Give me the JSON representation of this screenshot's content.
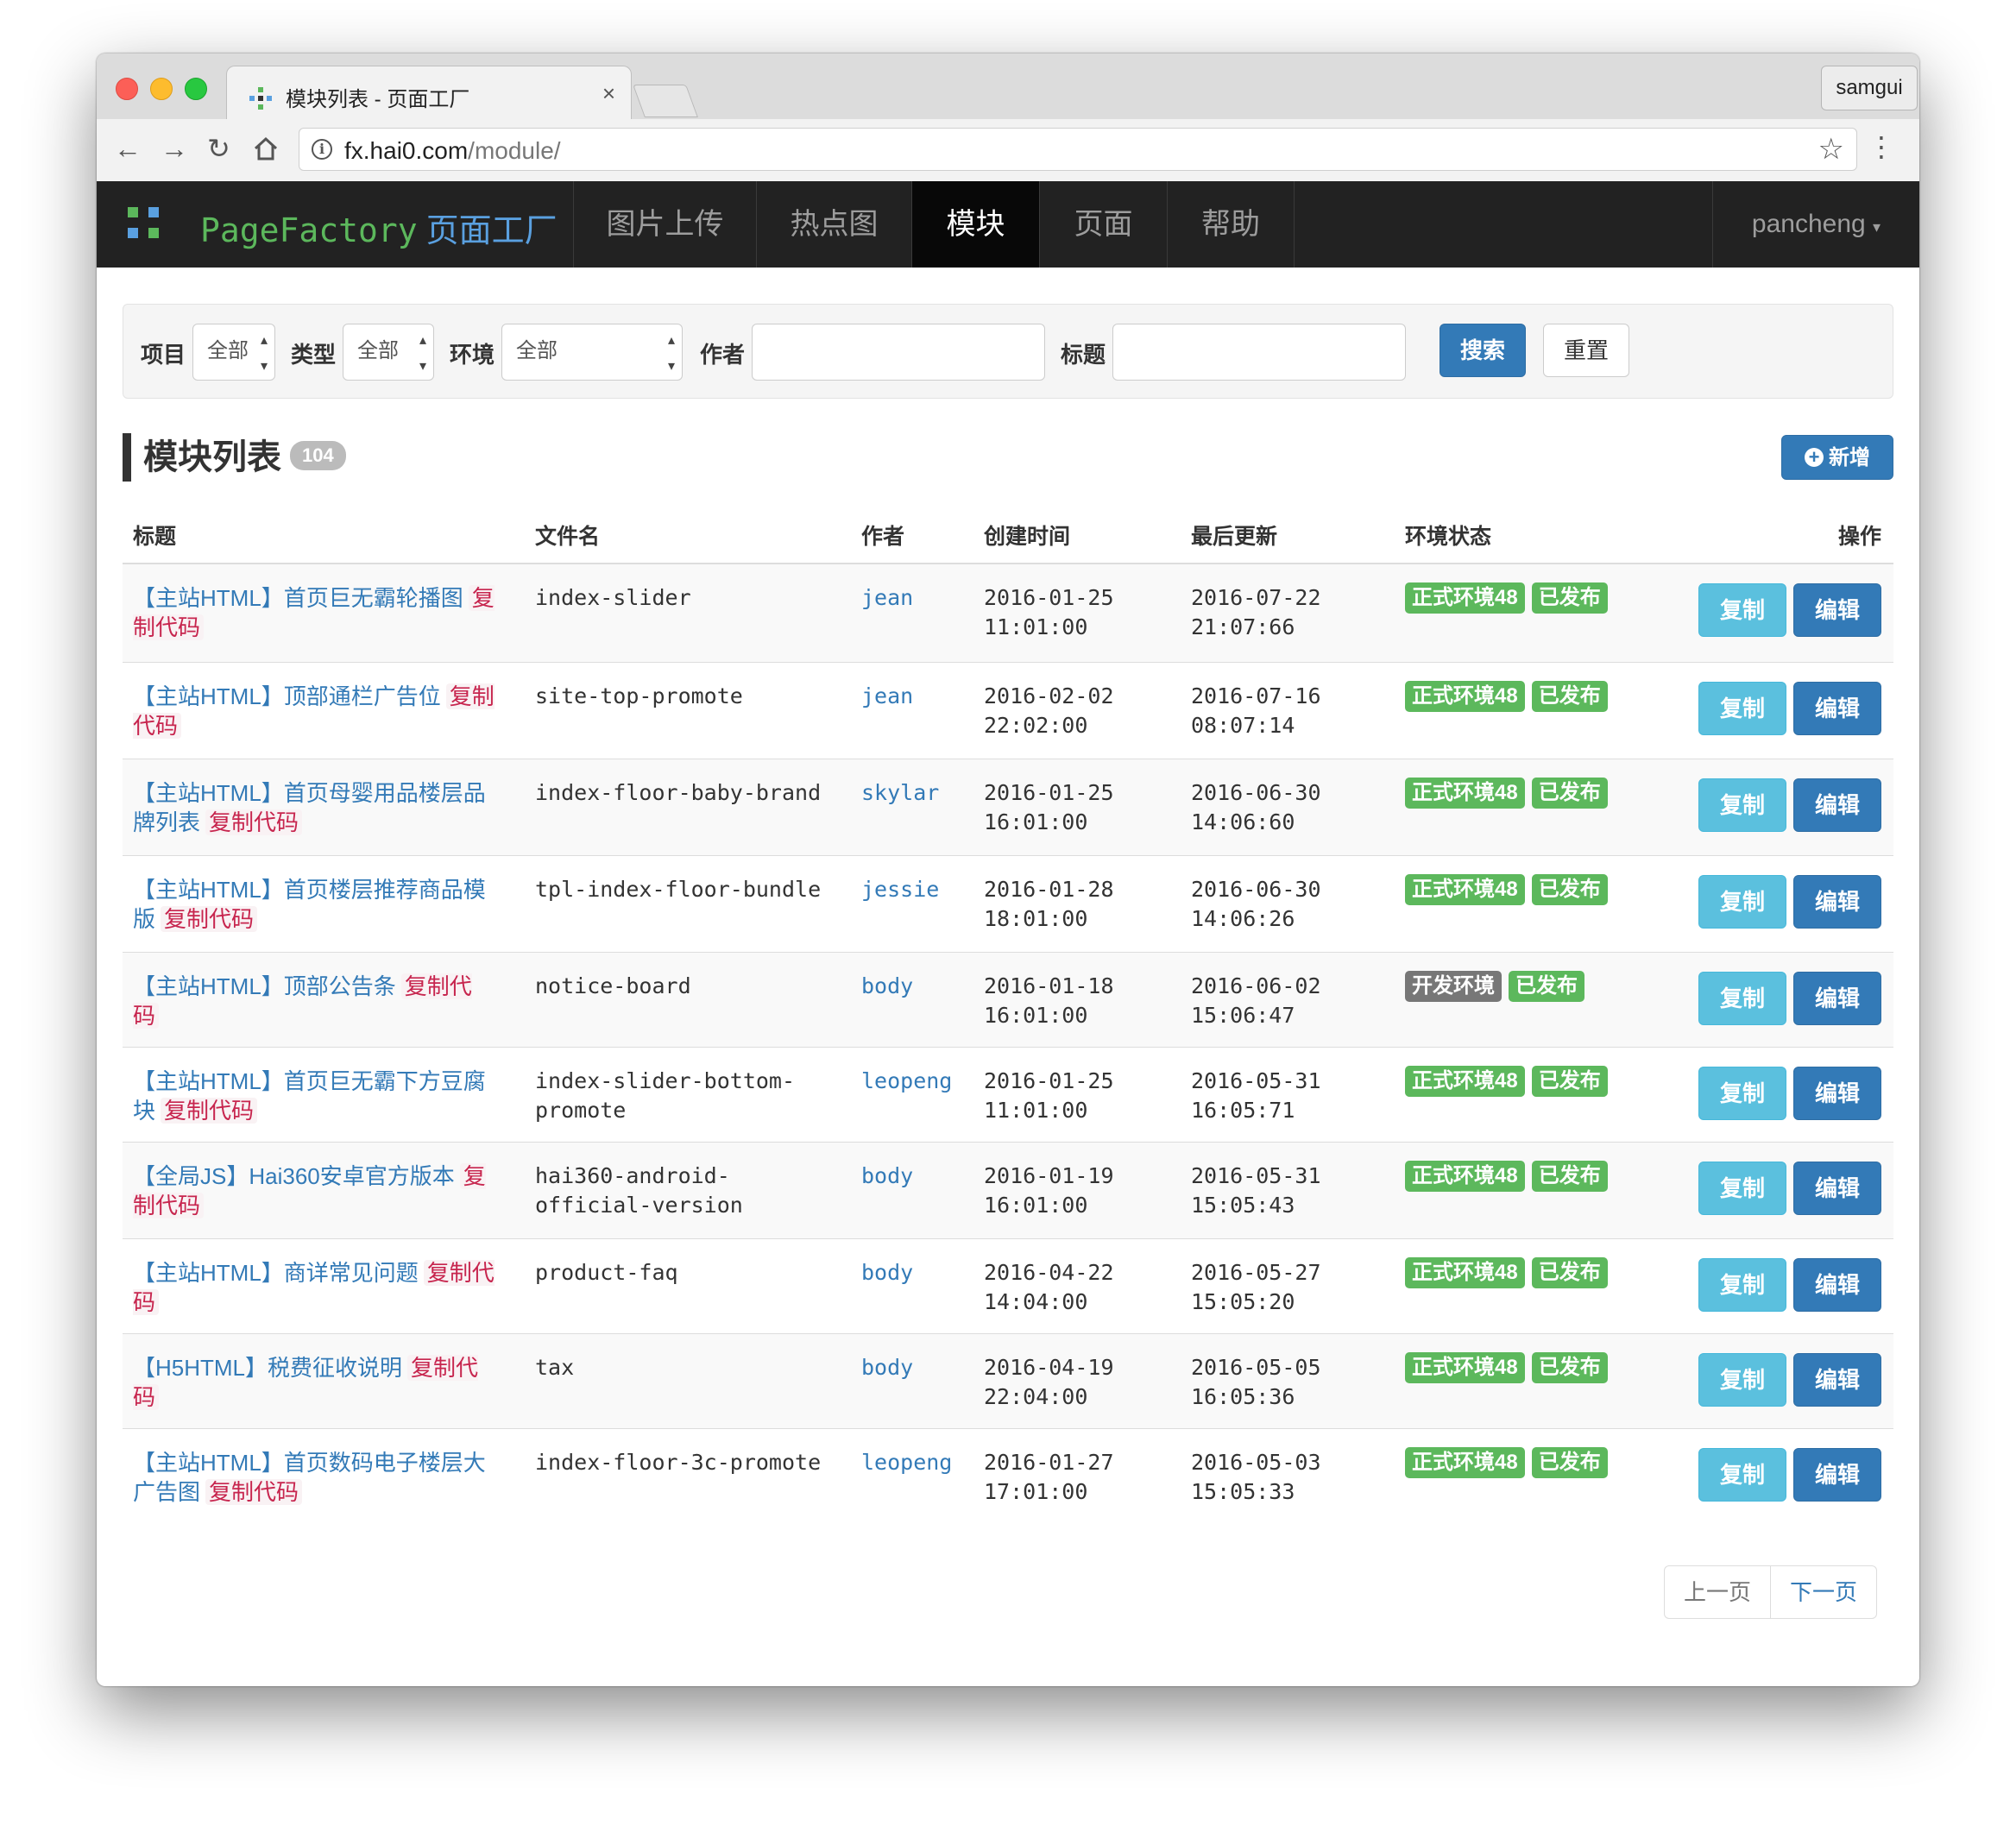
{
  "browser": {
    "tab_title": "模块列表 - 页面工厂",
    "tab_close": "×",
    "profile": "samgui",
    "url_host": "fx.hai0.com",
    "url_path": "/module/"
  },
  "navbar": {
    "brand": "PageFactory",
    "brand_cn": "页面工厂",
    "items": [
      {
        "label": "图片上传",
        "active": false
      },
      {
        "label": "热点图",
        "active": false
      },
      {
        "label": "模块",
        "active": true
      },
      {
        "label": "页面",
        "active": false
      },
      {
        "label": "帮助",
        "active": false
      }
    ],
    "user": "pancheng"
  },
  "filter": {
    "project_label": "项目",
    "project_value": "全部",
    "type_label": "类型",
    "type_value": "全部",
    "env_label": "环境",
    "env_value": "全部",
    "author_label": "作者",
    "author_value": "",
    "title_label": "标题",
    "title_value": "",
    "search_button": "搜索",
    "reset_button": "重置"
  },
  "heading": {
    "title": "模块列表",
    "count": "104",
    "add_button": "新增"
  },
  "table": {
    "columns": [
      "标题",
      "文件名",
      "作者",
      "创建时间",
      "最后更新",
      "环境状态",
      "操作"
    ],
    "copy_code_label": "复制代码",
    "copy_button": "复制",
    "edit_button": "编辑",
    "rows": [
      {
        "title_1": "【主站HTML】首页巨无霸轮播图",
        "title_2": "",
        "file_1": "index-slider",
        "file_2": "",
        "author": "jean",
        "created_date": "2016-01-25",
        "created_time": "11:01:00",
        "updated_date": "2016-07-22",
        "updated_time": "21:07:66",
        "env": "正式环境48",
        "env_color": "#5cb85c",
        "status": "已发布"
      },
      {
        "title_1": "【主站HTML】顶部通栏广告位",
        "title_2": "",
        "file_1": "site-top-promote",
        "file_2": "",
        "author": "jean",
        "created_date": "2016-02-02",
        "created_time": "22:02:00",
        "updated_date": "2016-07-16",
        "updated_time": "08:07:14",
        "env": "正式环境48",
        "env_color": "#5cb85c",
        "status": "已发布"
      },
      {
        "title_1": "【主站HTML】首页母婴用品楼层品牌列",
        "title_2": "表",
        "file_1": "index-floor-baby-brand",
        "file_2": "",
        "author": "skylar",
        "created_date": "2016-01-25",
        "created_time": "16:01:00",
        "updated_date": "2016-06-30",
        "updated_time": "14:06:60",
        "env": "正式环境48",
        "env_color": "#5cb85c",
        "status": "已发布"
      },
      {
        "title_1": "【主站HTML】首页楼层推荐商品模版",
        "title_2": "",
        "file_1": "tpl-index-floor-bundle",
        "file_2": "",
        "author": "jessie",
        "created_date": "2016-01-28",
        "created_time": "18:01:00",
        "updated_date": "2016-06-30",
        "updated_time": "14:06:26",
        "env": "正式环境48",
        "env_color": "#5cb85c",
        "status": "已发布"
      },
      {
        "title_1": "【主站HTML】顶部公告条",
        "title_2": "",
        "file_1": "notice-board",
        "file_2": "",
        "author": "body",
        "created_date": "2016-01-18",
        "created_time": "16:01:00",
        "updated_date": "2016-06-02",
        "updated_time": "15:06:47",
        "env": "开发环境",
        "env_color": "#777777",
        "status": "已发布"
      },
      {
        "title_1": "【主站HTML】首页巨无霸下方豆腐块",
        "title_2": "",
        "file_1": "index-slider-bottom-",
        "file_2": "promote",
        "author": "leopeng",
        "created_date": "2016-01-25",
        "created_time": "11:01:00",
        "updated_date": "2016-05-31",
        "updated_time": "16:05:71",
        "env": "正式环境48",
        "env_color": "#5cb85c",
        "status": "已发布"
      },
      {
        "title_1": "【全局JS】Hai360安卓官方版本",
        "title_2": "",
        "file_1": "hai360-android-",
        "file_2": "official-version",
        "author": "body",
        "created_date": "2016-01-19",
        "created_time": "16:01:00",
        "updated_date": "2016-05-31",
        "updated_time": "15:05:43",
        "env": "正式环境48",
        "env_color": "#5cb85c",
        "status": "已发布"
      },
      {
        "title_1": "【主站HTML】商详常见问题",
        "title_2": "",
        "file_1": "product-faq",
        "file_2": "",
        "author": "body",
        "created_date": "2016-04-22",
        "created_time": "14:04:00",
        "updated_date": "2016-05-27",
        "updated_time": "15:05:20",
        "env": "正式环境48",
        "env_color": "#5cb85c",
        "status": "已发布"
      },
      {
        "title_1": "【H5HTML】税费征收说明",
        "title_2": "",
        "file_1": "tax",
        "file_2": "",
        "author": "body",
        "created_date": "2016-04-19",
        "created_time": "22:04:00",
        "updated_date": "2016-05-05",
        "updated_time": "16:05:36",
        "env": "正式环境48",
        "env_color": "#5cb85c",
        "status": "已发布"
      },
      {
        "title_1": "【主站HTML】首页数码电子楼层大广告",
        "title_2": "图",
        "file_1": "index-floor-3c-promote",
        "file_2": "",
        "author": "leopeng",
        "created_date": "2016-01-27",
        "created_time": "17:01:00",
        "updated_date": "2016-05-03",
        "updated_time": "15:05:33",
        "env": "正式环境48",
        "env_color": "#5cb85c",
        "status": "已发布"
      }
    ]
  },
  "pagination": {
    "prev": "上一页",
    "next": "下一页"
  },
  "colors": {
    "primary": "#337ab7",
    "info": "#5bc0de",
    "success": "#5cb85c",
    "navbar": "#222222"
  }
}
